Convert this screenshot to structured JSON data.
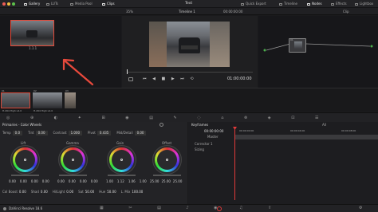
{
  "window": {
    "title": "Text"
  },
  "top_tabs": [
    {
      "label": "Gallery",
      "active": true
    },
    {
      "label": "LUTs",
      "active": false
    },
    {
      "label": "Media Pool",
      "active": false
    },
    {
      "label": "Clips",
      "active": true
    }
  ],
  "top_right_tabs": [
    {
      "label": "Quick Export",
      "active": false
    },
    {
      "label": "Timeline",
      "active": false
    },
    {
      "label": "Nodes",
      "active": true
    },
    {
      "label": "Effects",
      "active": false
    },
    {
      "label": "Lightbox",
      "active": false
    }
  ],
  "viewer": {
    "zoom": "35%",
    "timeline_name": "Timeline 1",
    "timecode_top": "00:00:00:00",
    "timecode": "01:00:00:00"
  },
  "gallery": {
    "still_label": "1.1.1"
  },
  "nodes": {
    "mode": "Clip",
    "node_label": "01"
  },
  "clips": [
    {
      "number": "01",
      "timecode": "00:00:00:00",
      "codec": "H.264 High L4.0"
    },
    {
      "number": "02",
      "timecode": "00:00:00:00",
      "codec": "H.264 High L4.0"
    },
    {
      "number": "03",
      "timecode": "",
      "codec": ""
    }
  ],
  "primaries": {
    "title": "Primaries - Color Wheels",
    "params": [
      {
        "label": "Temp",
        "value": "0.0"
      },
      {
        "label": "Tint",
        "value": "0.00"
      },
      {
        "label": "Contrast",
        "value": "1.000"
      },
      {
        "label": "Pivot",
        "value": "0.435"
      },
      {
        "label": "Mid/Detail",
        "value": "0.00"
      }
    ],
    "wheels": [
      {
        "name": "Lift",
        "values": [
          "0.00",
          "0.00",
          "0.00",
          "0.00"
        ]
      },
      {
        "name": "Gamma",
        "values": [
          "0.00",
          "0.00",
          "0.00",
          "0.00"
        ]
      },
      {
        "name": "Gain",
        "values": [
          "1.00",
          "1.12",
          "1.06",
          "1.00"
        ]
      },
      {
        "name": "Offset",
        "values": [
          "25.00",
          "25.00",
          "25.00"
        ]
      }
    ],
    "bottom": [
      {
        "label": "Col Boost",
        "value": "0.00"
      },
      {
        "label": "Shad",
        "value": "0.00"
      },
      {
        "label": "Hi/Light",
        "value": "0.00"
      },
      {
        "label": "Sat",
        "value": "50.00"
      },
      {
        "label": "Hue",
        "value": "50.00"
      },
      {
        "label": "L. Mix",
        "value": "100.00"
      }
    ]
  },
  "keyframes": {
    "title": "Keyframes",
    "filter": "All",
    "timecode": "00:00:00:00",
    "ruler": [
      "00:00:00:00",
      "00:00:04:00",
      "00:00:08:00"
    ],
    "tracks": [
      "Master",
      "Corrector 1",
      "Sizing"
    ]
  },
  "app": {
    "name": "DaVinci Resolve 18.6"
  },
  "colors": {
    "accent": "#e14a3d",
    "playhead": "#e13a3a",
    "panel": "#17171a"
  }
}
